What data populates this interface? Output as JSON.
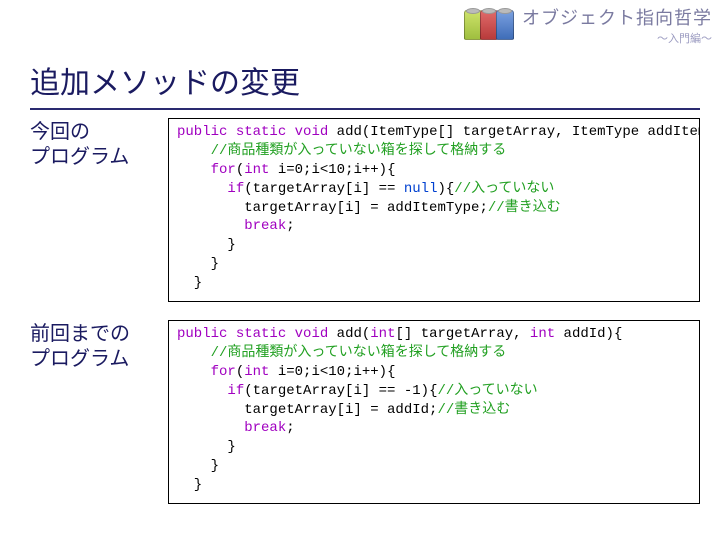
{
  "header": {
    "title": "オブジェクト指向哲学",
    "subtitle": "～入門編～"
  },
  "slide_title": "追加メソッドの変更",
  "block1": {
    "label": "今回の\nプログラム",
    "code_plain": "public static void add(ItemType[] targetArray, ItemType addItemType){\n    //商品種類が入っていない箱を探して格納する\n    for(int i=0;i<10;i++){\n      if(targetArray[i] == null){//入っていない\n        targetArray[i] = addItemType;//書き込む\n        break;\n      }\n    }\n  }",
    "code_html": "<span class=\"kw\">public</span> <span class=\"kw\">static</span> <span class=\"kw\">void</span> add(ItemType[] targetArray, ItemType addItemType){\n    <span class=\"cm\">//商品種類が入っていない箱を探して格納する</span>\n    <span class=\"kw\">for</span>(<span class=\"kw\">int</span> i=0;i&lt;10;i++){\n      <span class=\"kw\">if</span>(targetArray[i] == <span class=\"nl\">null</span>){<span class=\"cm\">//入っていない</span>\n        targetArray[i] = addItemType;<span class=\"cm\">//書き込む</span>\n        <span class=\"kw\">break</span>;\n      }\n    }\n  }"
  },
  "block2": {
    "label": "前回までの\nプログラム",
    "code_plain": "public static void add(int[] targetArray, int addId){\n    //商品種類が入っていない箱を探して格納する\n    for(int i=0;i<10;i++){\n      if(targetArray[i] == -1){//入っていない\n        targetArray[i] = addId;//書き込む\n        break;\n      }\n    }\n  }",
    "code_html": "<span class=\"kw\">public</span> <span class=\"kw\">static</span> <span class=\"kw\">void</span> add(<span class=\"kw\">int</span>[] targetArray, <span class=\"kw\">int</span> addId){\n    <span class=\"cm\">//商品種類が入っていない箱を探して格納する</span>\n    <span class=\"kw\">for</span>(<span class=\"kw\">int</span> i=0;i&lt;10;i++){\n      <span class=\"kw\">if</span>(targetArray[i] == -1){<span class=\"cm\">//入っていない</span>\n        targetArray[i] = addId;<span class=\"cm\">//書き込む</span>\n        <span class=\"kw\">break</span>;\n      }\n    }\n  }"
  }
}
